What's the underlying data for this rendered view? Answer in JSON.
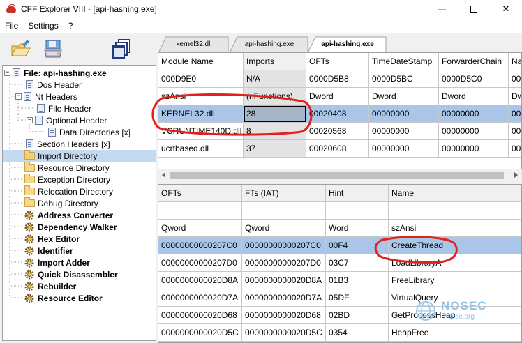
{
  "window": {
    "title": "CFF Explorer VIII - [api-hashing.exe]",
    "controls": {
      "minimize": "—",
      "maximize": "",
      "close": "✕"
    }
  },
  "menu": [
    "File",
    "Settings",
    "?"
  ],
  "toolbar": {
    "icons": [
      "open-file-icon",
      "save-icon",
      "windows-icon"
    ]
  },
  "tree": {
    "items": [
      {
        "label": "File: api-hashing.exe",
        "icon": "doc-icon",
        "bold": true
      },
      {
        "label": "Dos Header",
        "icon": "doc-icon"
      },
      {
        "label": "Nt Headers",
        "icon": "doc-icon"
      },
      {
        "label": "File Header",
        "icon": "doc-icon"
      },
      {
        "label": "Optional Header",
        "icon": "doc-icon"
      },
      {
        "label": "Data Directories [x]",
        "icon": "doc-icon"
      },
      {
        "label": "Section Headers [x]",
        "icon": "doc-icon"
      },
      {
        "label": "Import Directory",
        "icon": "folder-open-icon",
        "selected": true
      },
      {
        "label": "Resource Directory",
        "icon": "folder-icon"
      },
      {
        "label": "Exception Directory",
        "icon": "folder-icon"
      },
      {
        "label": "Relocation Directory",
        "icon": "folder-icon"
      },
      {
        "label": "Debug Directory",
        "icon": "folder-icon"
      },
      {
        "label": "Address Converter",
        "icon": "gear-icon",
        "bold": true
      },
      {
        "label": "Dependency Walker",
        "icon": "gear-icon",
        "bold": true
      },
      {
        "label": "Hex Editor",
        "icon": "gear-icon",
        "bold": true
      },
      {
        "label": "Identifier",
        "icon": "gear-icon",
        "bold": true
      },
      {
        "label": "Import Adder",
        "icon": "gear-icon",
        "bold": true
      },
      {
        "label": "Quick Disassembler",
        "icon": "gear-icon",
        "bold": true
      },
      {
        "label": "Rebuilder",
        "icon": "gear-icon",
        "bold": true
      },
      {
        "label": "Resource Editor",
        "icon": "gear-icon",
        "bold": true
      }
    ]
  },
  "tabs": [
    {
      "label": "kernel32.dll",
      "active": false
    },
    {
      "label": "api-hashing.exe",
      "active": false
    },
    {
      "label": "api-hashing.exe",
      "active": true
    }
  ],
  "imports_table": {
    "columns": [
      "Module Name",
      "Imports",
      "OFTs",
      "TimeDateStamp",
      "ForwarderChain",
      "Na"
    ],
    "offset_row": [
      "000D9E0",
      "N/A",
      "0000D5B8",
      "0000D5BC",
      "0000D5C0",
      "00"
    ],
    "type_row": [
      "szAnsi",
      "(nFunctions)",
      "Dword",
      "Dword",
      "Dword",
      "Dw"
    ],
    "rows": [
      [
        "KERNEL32.dll",
        "28",
        "00020408",
        "00000000",
        "00000000",
        "00"
      ],
      [
        "VCRUNTIME140D.dll",
        "8",
        "00020568",
        "00000000",
        "00000000",
        "00"
      ],
      [
        "ucrtbased.dll",
        "37",
        "00020608",
        "00000000",
        "00000000",
        "00"
      ]
    ]
  },
  "functions_table": {
    "columns": [
      "OFTs",
      "FTs (IAT)",
      "Hint",
      "Name"
    ],
    "empty_row": [
      "",
      "",
      "",
      ""
    ],
    "type_row": [
      "Qword",
      "Qword",
      "Word",
      "szAnsi"
    ],
    "rows": [
      [
        "00000000000207C0",
        "00000000000207C0",
        "00F4",
        "CreateThread"
      ],
      [
        "00000000000207D0",
        "00000000000207D0",
        "03C7",
        "LoadLibraryA"
      ],
      [
        "0000000000020D8A",
        "0000000000020D8A",
        "01B3",
        "FreeLibrary"
      ],
      [
        "0000000000020D7A",
        "0000000000020D7A",
        "05DF",
        "VirtualQuery"
      ],
      [
        "0000000000020D68",
        "0000000000020D68",
        "02BD",
        "GetProcessHeap"
      ],
      [
        "0000000000020D5C",
        "0000000000020D5C",
        "0354",
        "HeapFree"
      ]
    ]
  },
  "watermark": {
    "title": "NOSEC",
    "subtitle": "nosec.org"
  },
  "colors": {
    "selection": "#a9c6e8",
    "tree_selection": "#c3daf0",
    "annotation": "#e0211d"
  }
}
